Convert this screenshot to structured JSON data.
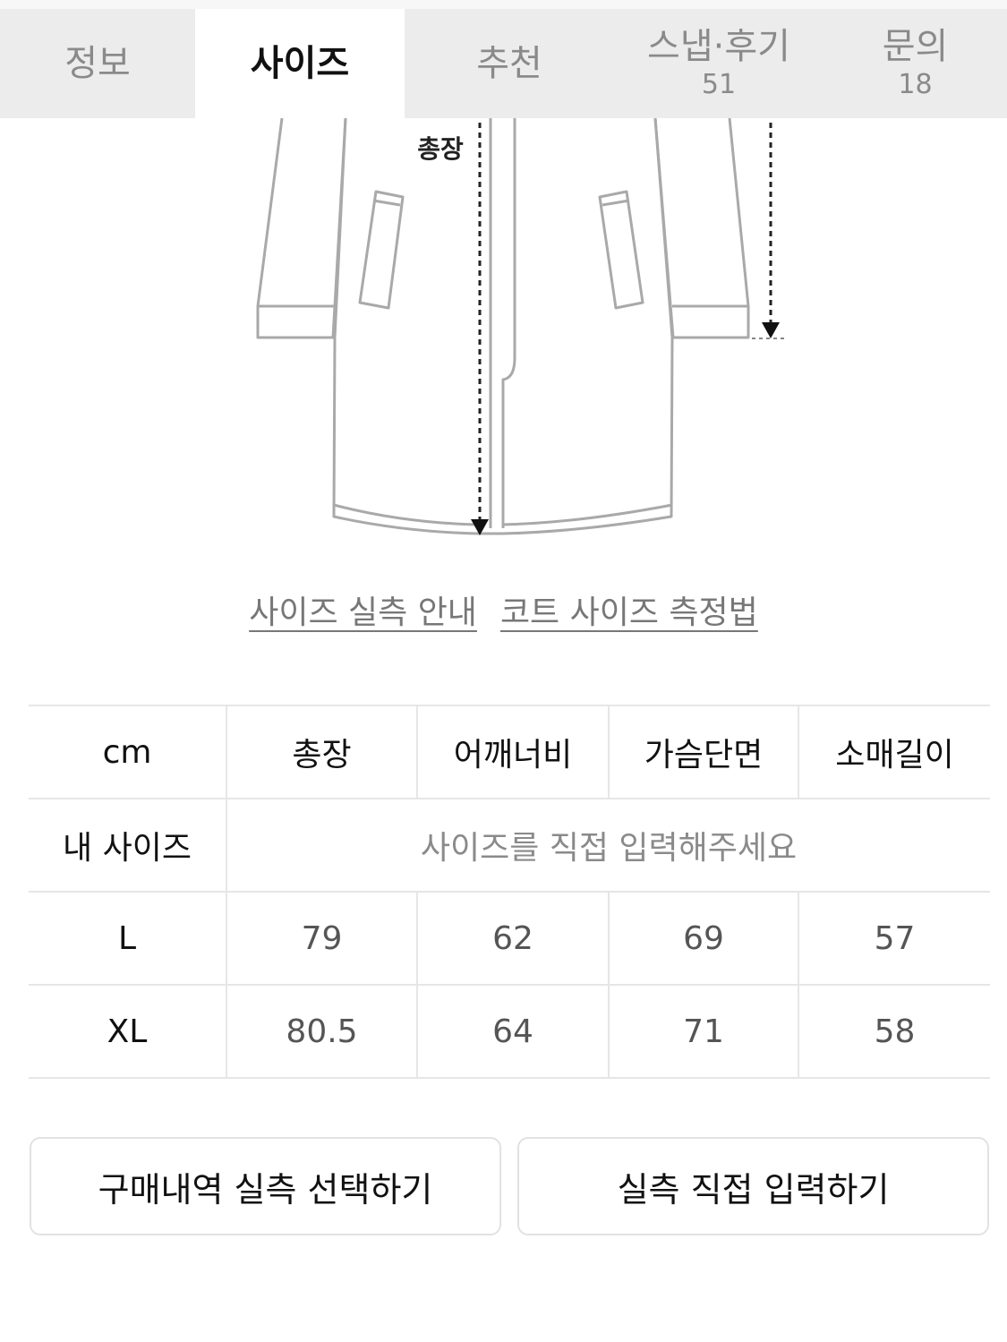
{
  "tabs": [
    {
      "label": "정보",
      "count": ""
    },
    {
      "label": "사이즈",
      "count": ""
    },
    {
      "label": "추천",
      "count": ""
    },
    {
      "label": "스냅·후기",
      "count": "51"
    },
    {
      "label": "문의",
      "count": "18"
    }
  ],
  "active_tab": "사이즈",
  "diagram": {
    "length_label": "총장"
  },
  "links": {
    "size_guide": "사이즈 실측 안내",
    "coat_measure": "코트 사이즈 측정법"
  },
  "size_table": {
    "header": {
      "unit": "cm",
      "columns": [
        "총장",
        "어깨너비",
        "가슴단면",
        "소매길이"
      ]
    },
    "my_size": {
      "label": "내 사이즈",
      "placeholder": "사이즈를 직접 입력해주세요"
    },
    "rows": [
      {
        "size": "L",
        "values": [
          "79",
          "62",
          "69",
          "57"
        ]
      },
      {
        "size": "XL",
        "values": [
          "80.5",
          "64",
          "71",
          "58"
        ]
      }
    ]
  },
  "buttons": {
    "purchase_history": "구매내역 실측 선택하기",
    "direct_input": "실측 직접 입력하기"
  },
  "colors": {
    "tab_bg": "#ececec",
    "active_tab_bg": "#ffffff",
    "border": "#e6e6e6"
  }
}
